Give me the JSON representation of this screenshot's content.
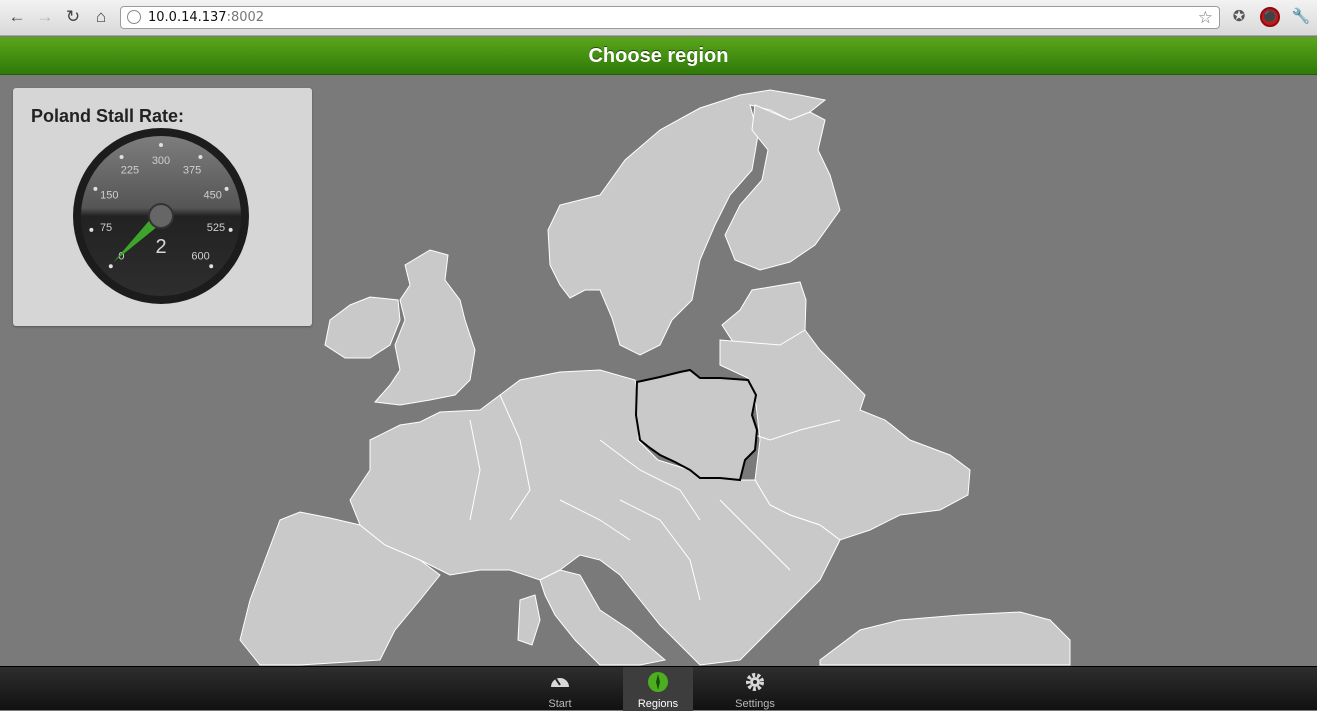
{
  "browser": {
    "url_host": "10.0.14.137",
    "url_port": ":8002",
    "back_icon": "arrow-left-icon",
    "forward_icon": "arrow-right-icon",
    "reload_icon": "reload-icon",
    "home_icon": "home-icon",
    "bookmark_icon": "star-icon",
    "extensions": [
      "puzzle-extension-icon",
      "stop-icon",
      "wrench-icon"
    ]
  },
  "header": {
    "title": "Choose region"
  },
  "gauge_panel": {
    "title": "Poland Stall Rate:",
    "value": "2",
    "scale_labels": [
      "0",
      "75",
      "150",
      "225",
      "300",
      "375",
      "450",
      "525",
      "600"
    ],
    "min": 0,
    "max": 600,
    "needle_color": "#3ea52b"
  },
  "map": {
    "highlighted_region": "Poland"
  },
  "tabs": [
    {
      "label": "Start",
      "icon": "speedometer-icon",
      "active": false
    },
    {
      "label": "Regions",
      "icon": "compass-icon",
      "active": true
    },
    {
      "label": "Settings",
      "icon": "gear-icon",
      "active": false
    }
  ],
  "colors": {
    "header_green": "#4a9412",
    "accent_green": "#3ea52b",
    "map_land": "#c9c9c9",
    "background": "#7a7a7a"
  }
}
